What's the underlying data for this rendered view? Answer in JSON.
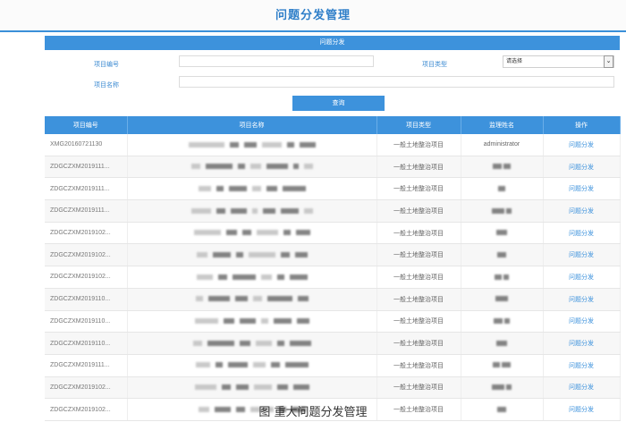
{
  "header": {
    "title": "问题分发管理"
  },
  "search": {
    "panel_title": "问题分发",
    "project_code_label": "项目编号",
    "project_type_label": "项目类型",
    "project_type_value": "请选择",
    "project_name_label": "项目名称",
    "query_button": "查询"
  },
  "table": {
    "columns": [
      "项目编号",
      "项目名称",
      "项目类型",
      "监理姓名",
      "操作"
    ],
    "rows": [
      {
        "code": "XMG20160721130",
        "type": "一般土地整治项目",
        "supervisor": "administrator",
        "action": "问题分发"
      },
      {
        "code": "ZDGCZXM2019111...",
        "type": "一般土地整治项目",
        "supervisor": "",
        "action": "问题分发"
      },
      {
        "code": "ZDGCZXM2019111...",
        "type": "一般土地整治项目",
        "supervisor": "",
        "action": "问题分发"
      },
      {
        "code": "ZDGCZXM2019111...",
        "type": "一般土地整治项目",
        "supervisor": "",
        "action": "问题分发"
      },
      {
        "code": "ZDGCZXM2019102...",
        "type": "一般土地整治项目",
        "supervisor": "",
        "action": "问题分发"
      },
      {
        "code": "ZDGCZXM2019102...",
        "type": "一般土地整治项目",
        "supervisor": "",
        "action": "问题分发"
      },
      {
        "code": "ZDGCZXM2019102...",
        "type": "一般土地整治项目",
        "supervisor": "",
        "action": "问题分发"
      },
      {
        "code": "ZDGCZXM2019110...",
        "type": "一般土地整治项目",
        "supervisor": "",
        "action": "问题分发"
      },
      {
        "code": "ZDGCZXM2019110...",
        "type": "一般土地整治项目",
        "supervisor": "",
        "action": "问题分发"
      },
      {
        "code": "ZDGCZXM2019110...",
        "type": "一般土地整治项目",
        "supervisor": "",
        "action": "问题分发"
      },
      {
        "code": "ZDGCZXM2019111...",
        "type": "一般土地整治项目",
        "supervisor": "",
        "action": "问题分发"
      },
      {
        "code": "ZDGCZXM2019102...",
        "type": "一般土地整治项目",
        "supervisor": "",
        "action": "问题分发"
      },
      {
        "code": "ZDGCZXM2019102...",
        "type": "一般土地整治项目",
        "supervisor": "",
        "action": "问题分发"
      }
    ]
  },
  "caption": "图 重大问题分发管理"
}
